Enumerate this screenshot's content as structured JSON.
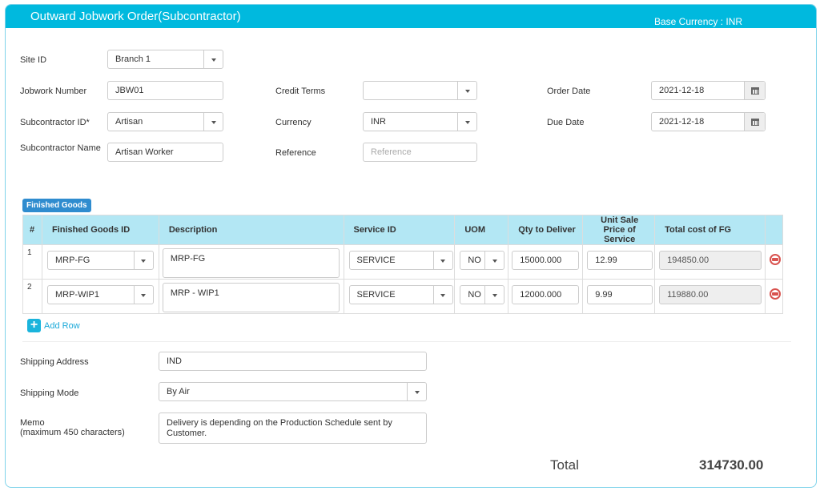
{
  "header": {
    "title": "Outward Jobwork Order(Subcontractor)",
    "base_currency": "Base Currency : INR"
  },
  "form": {
    "site_id": {
      "label": "Site ID",
      "value": "Branch 1"
    },
    "jobwork_number": {
      "label": "Jobwork Number",
      "value": "JBW01"
    },
    "subcontractor_id": {
      "label": "Subcontractor ID*",
      "value": "Artisan"
    },
    "subcontractor_name": {
      "label": "Subcontractor Name",
      "value": "Artisan Worker"
    },
    "credit_terms": {
      "label": "Credit Terms",
      "value": ""
    },
    "currency": {
      "label": "Currency",
      "value": "INR"
    },
    "reference": {
      "label": "Reference",
      "value": "",
      "placeholder": "Reference"
    },
    "order_date": {
      "label": "Order Date",
      "value": "2021-12-18"
    },
    "due_date": {
      "label": "Due Date",
      "value": "2021-12-18"
    }
  },
  "finished_goods": {
    "badge": "Finished Goods",
    "columns": [
      "#",
      "Finished Goods ID",
      "Description",
      "Service ID",
      "UOM",
      "Qty to Deliver",
      "Unit Sale Price of Service",
      "Total cost of FG",
      ""
    ],
    "rows": [
      {
        "num": "1",
        "fg_id": "MRP-FG",
        "description": "MRP-FG",
        "service_id": "SERVICE",
        "uom": "NO",
        "qty": "15000.000",
        "unit_price": "12.99",
        "total": "194850.00"
      },
      {
        "num": "2",
        "fg_id": "MRP-WIP1",
        "description": "MRP - WIP1",
        "service_id": "SERVICE",
        "uom": "NO",
        "qty": "12000.000",
        "unit_price": "9.99",
        "total": "119880.00"
      }
    ],
    "add_row_label": "Add Row"
  },
  "shipping": {
    "address": {
      "label": "Shipping Address",
      "value": "IND"
    },
    "mode": {
      "label": "Shipping Mode",
      "value": "By Air"
    },
    "memo": {
      "label": "Memo",
      "sublabel": "(maximum 450 characters)",
      "value": "Delivery is depending on the Production Schedule sent by Customer."
    }
  },
  "summary": {
    "total_label": "Total",
    "total_value": "314730.00"
  }
}
